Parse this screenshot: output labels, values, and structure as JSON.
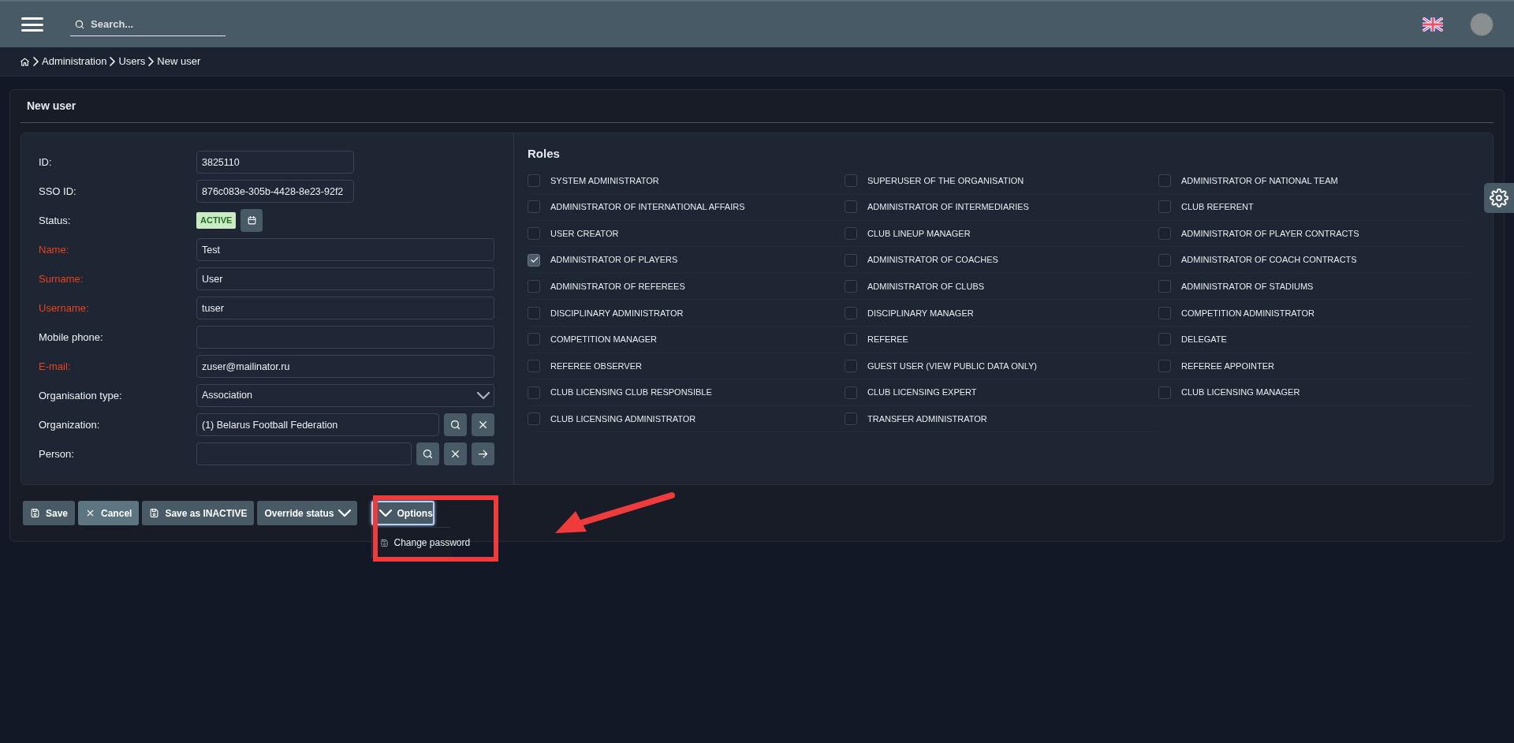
{
  "topbar": {
    "search": {
      "placeholder": "Search..."
    }
  },
  "breadcrumb": [
    "Administration",
    "Users",
    "New user"
  ],
  "panel_title": "New user",
  "fields": [
    {
      "kind": "text",
      "label": "ID:",
      "required": false,
      "value": "3825110",
      "short": true
    },
    {
      "kind": "text",
      "label": "SSO ID:",
      "required": false,
      "value": "876c083e-305b-4428-8e23-92f2",
      "short": true
    },
    {
      "kind": "status",
      "label": "Status:",
      "required": false,
      "value": "ACTIVE"
    },
    {
      "kind": "text",
      "label": "Name:",
      "required": true,
      "value": "Test"
    },
    {
      "kind": "text",
      "label": "Surname:",
      "required": true,
      "value": "User"
    },
    {
      "kind": "text",
      "label": "Username:",
      "required": true,
      "value": "tuser"
    },
    {
      "kind": "text",
      "label": "Mobile phone:",
      "required": false
    },
    {
      "kind": "text",
      "label": "E-mail:",
      "required": true,
      "value": "zuser@mailinator.ru"
    },
    {
      "kind": "select",
      "label": "Organisation type:",
      "required": false,
      "value": "Association"
    },
    {
      "kind": "lookup",
      "label": "Organization:",
      "required": false,
      "value": "(1) Belarus Football Federation",
      "actions": [
        {
          "kind": "search"
        },
        {
          "kind": "clear"
        }
      ]
    },
    {
      "kind": "lookup",
      "label": "Person:",
      "required": false,
      "actions": [
        {
          "kind": "search"
        },
        {
          "kind": "clear"
        },
        {
          "kind": "go"
        }
      ]
    }
  ],
  "roles": {
    "title": "Roles",
    "items": [
      {
        "label": "SYSTEM ADMINISTRATOR",
        "checked": false
      },
      {
        "label": "SUPERUSER OF THE ORGANISATION",
        "checked": false
      },
      {
        "label": "ADMINISTRATOR OF NATIONAL TEAM",
        "checked": false
      },
      {
        "label": "ADMINISTRATOR OF INTERNATIONAL AFFAIRS",
        "checked": false
      },
      {
        "label": "ADMINISTRATOR OF INTERMEDIARIES",
        "checked": false
      },
      {
        "label": "CLUB REFERENT",
        "checked": false
      },
      {
        "label": "USER CREATOR",
        "checked": false
      },
      {
        "label": "CLUB LINEUP MANAGER",
        "checked": false
      },
      {
        "label": "ADMINISTRATOR OF PLAYER CONTRACTS",
        "checked": false
      },
      {
        "label": "ADMINISTRATOR OF PLAYERS",
        "checked": true
      },
      {
        "label": "ADMINISTRATOR OF COACHES",
        "checked": false
      },
      {
        "label": "ADMINISTRATOR OF COACH CONTRACTS",
        "checked": false
      },
      {
        "label": "ADMINISTRATOR OF REFEREES",
        "checked": false
      },
      {
        "label": "ADMINISTRATOR OF CLUBS",
        "checked": false
      },
      {
        "label": "ADMINISTRATOR OF STADIUMS",
        "checked": false
      },
      {
        "label": "DISCIPLINARY ADMINISTRATOR",
        "checked": false
      },
      {
        "label": "DISCIPLINARY MANAGER",
        "checked": false
      },
      {
        "label": "COMPETITION ADMINISTRATOR",
        "checked": false
      },
      {
        "label": "COMPETITION MANAGER",
        "checked": false
      },
      {
        "label": "REFEREE",
        "checked": false
      },
      {
        "label": "DELEGATE",
        "checked": false
      },
      {
        "label": "REFEREE OBSERVER",
        "checked": false
      },
      {
        "label": "GUEST USER (VIEW PUBLIC DATA ONLY)",
        "checked": false
      },
      {
        "label": "REFEREE APPOINTER",
        "checked": false
      },
      {
        "label": "CLUB LICENSING CLUB RESPONSIBLE",
        "checked": false
      },
      {
        "label": "CLUB LICENSING EXPERT",
        "checked": false
      },
      {
        "label": "CLUB LICENSING MANAGER",
        "checked": false
      },
      {
        "label": "CLUB LICENSING ADMINISTRATOR",
        "checked": false
      },
      {
        "label": "TRANSFER ADMINISTRATOR",
        "checked": false
      }
    ]
  },
  "buttons": [
    {
      "kind": "save",
      "label": "Save",
      "hovered": false
    },
    {
      "kind": "cancel",
      "label": "Cancel",
      "hovered": true
    },
    {
      "kind": "save",
      "label": "Save as INACTIVE",
      "hovered": false
    },
    {
      "kind": "menu",
      "label": "Override status",
      "expanded": false,
      "hovered": false
    },
    {
      "kind": "menu",
      "label": "Options",
      "expanded": true,
      "hovered": false,
      "menu": [
        {
          "label": "Change password"
        }
      ]
    }
  ]
}
